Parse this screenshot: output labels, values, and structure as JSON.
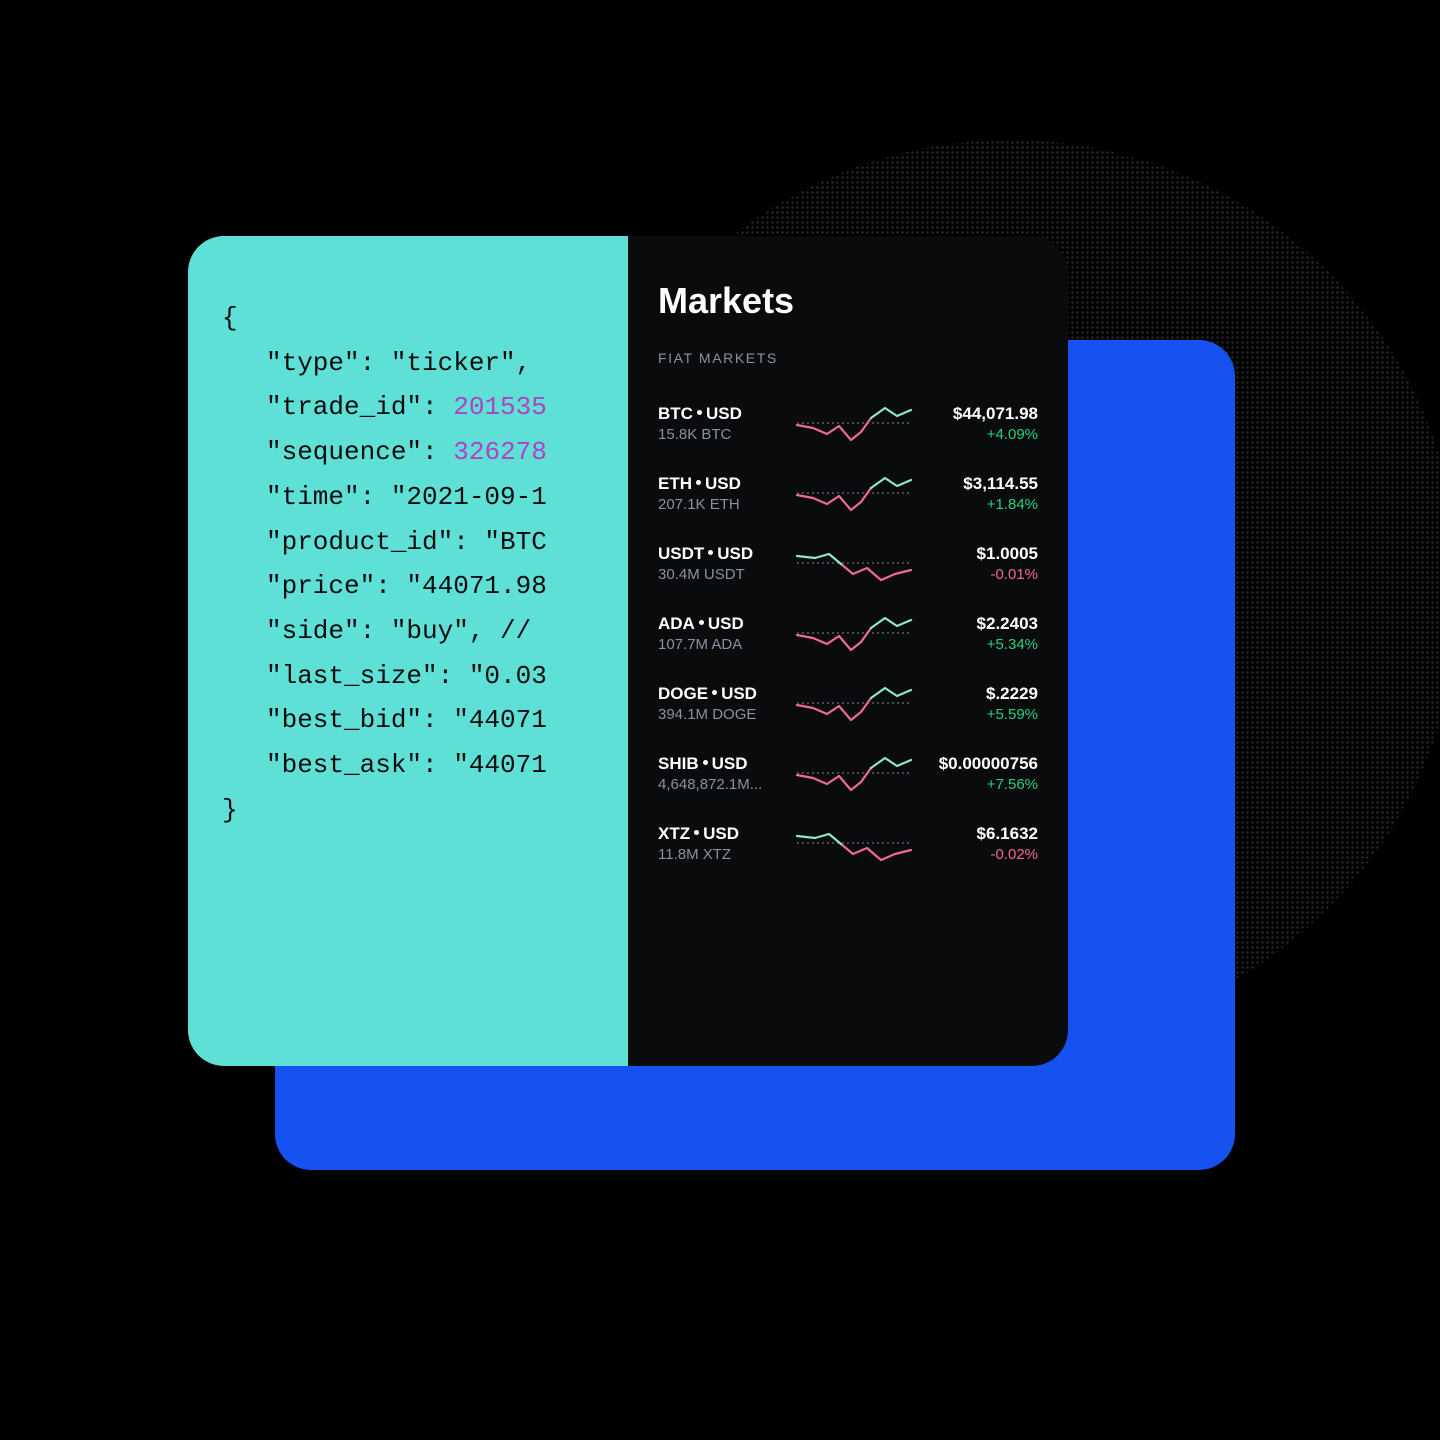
{
  "code": {
    "lines": [
      {
        "text": "{",
        "indent": false
      },
      {
        "text": "\"type\": \"ticker\",",
        "indent": true
      },
      {
        "key": "\"trade_id\": ",
        "num": "201535",
        "indent": true
      },
      {
        "key": "\"sequence\": ",
        "num": "326278",
        "indent": true
      },
      {
        "text": "\"time\": \"2021-09-1",
        "indent": true
      },
      {
        "text": "\"product_id\": \"BTC",
        "indent": true
      },
      {
        "text": "\"price\": \"44071.98",
        "indent": true
      },
      {
        "text": "\"side\": \"buy\", // ",
        "indent": true
      },
      {
        "text": "\"last_size\": \"0.03",
        "indent": true
      },
      {
        "text": "\"best_bid\": \"44071",
        "indent": true
      },
      {
        "text": "\"best_ask\": \"44071",
        "indent": true
      },
      {
        "text": "}",
        "indent": false
      }
    ]
  },
  "markets": {
    "title": "Markets",
    "subtitle": "FIAT MARKETS",
    "rows": [
      {
        "base": "BTC",
        "quote": "USD",
        "volume": "15.8K BTC",
        "price": "$44,071.98",
        "change": "+4.09%",
        "dir": "up",
        "spark": "A"
      },
      {
        "base": "ETH",
        "quote": "USD",
        "volume": "207.1K ETH",
        "price": "$3,114.55",
        "change": "+1.84%",
        "dir": "up",
        "spark": "A"
      },
      {
        "base": "USDT",
        "quote": "USD",
        "volume": "30.4M USDT",
        "price": "$1.0005",
        "change": "-0.01%",
        "dir": "down",
        "spark": "B"
      },
      {
        "base": "ADA",
        "quote": "USD",
        "volume": "107.7M ADA",
        "price": "$2.2403",
        "change": "+5.34%",
        "dir": "up",
        "spark": "A"
      },
      {
        "base": "DOGE",
        "quote": "USD",
        "volume": "394.1M DOGE",
        "price": "$.2229",
        "change": "+5.59%",
        "dir": "up",
        "spark": "A"
      },
      {
        "base": "SHIB",
        "quote": "USD",
        "volume": "4,648,872.1M...",
        "price": "$0.00000756",
        "change": "+7.56%",
        "dir": "up",
        "spark": "A"
      },
      {
        "base": "XTZ",
        "quote": "USD",
        "volume": "11.8M XTZ",
        "price": "$6.1632",
        "change": "-0.02%",
        "dir": "down",
        "spark": "B"
      }
    ]
  }
}
